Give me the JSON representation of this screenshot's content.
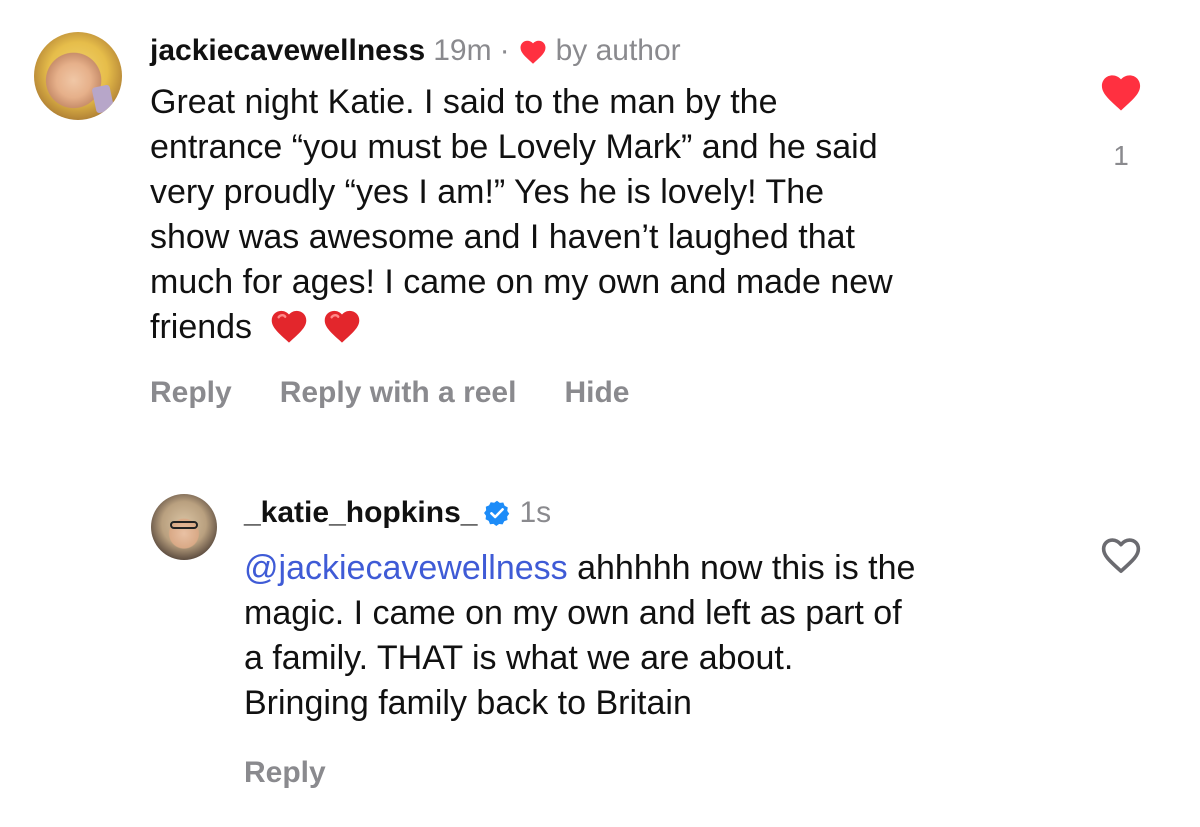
{
  "comments": [
    {
      "username": "jackiecavewellness",
      "time": "19m",
      "separator": "·",
      "liked_by_author_label": "by author",
      "lines": [
        "Great night Katie. I said to the man by the",
        "entrance “you must be Lovely Mark” and he said",
        "very proudly “yes I am!” Yes he is lovely! The",
        "show was awesome and I haven’t laughed that",
        "much for ages! I came on my own and made new",
        "friends"
      ],
      "actions": {
        "reply": "Reply",
        "reply_reel": "Reply with a reel",
        "hide": "Hide"
      },
      "like_count": "1",
      "liked": true
    },
    {
      "username": "_katie_hopkins_",
      "verified": true,
      "time": "1s",
      "mention": "@jackiecavewellness",
      "lines": [
        " ahhhhh now this is the",
        "magic. I came on my own and left as part of",
        "a family. THAT is what we are about.",
        "Bringing family back to Britain"
      ],
      "actions": {
        "reply": "Reply"
      },
      "liked": false
    }
  ],
  "colors": {
    "like_red": "#ff3040",
    "mention_blue": "#3f5bd6",
    "meta_gray": "#8a8a8e",
    "verified_blue": "#1d8cf8"
  },
  "icons": [
    "heart-filled-icon",
    "heart-outline-icon",
    "verified-badge-icon",
    "red-heart-emoji"
  ]
}
